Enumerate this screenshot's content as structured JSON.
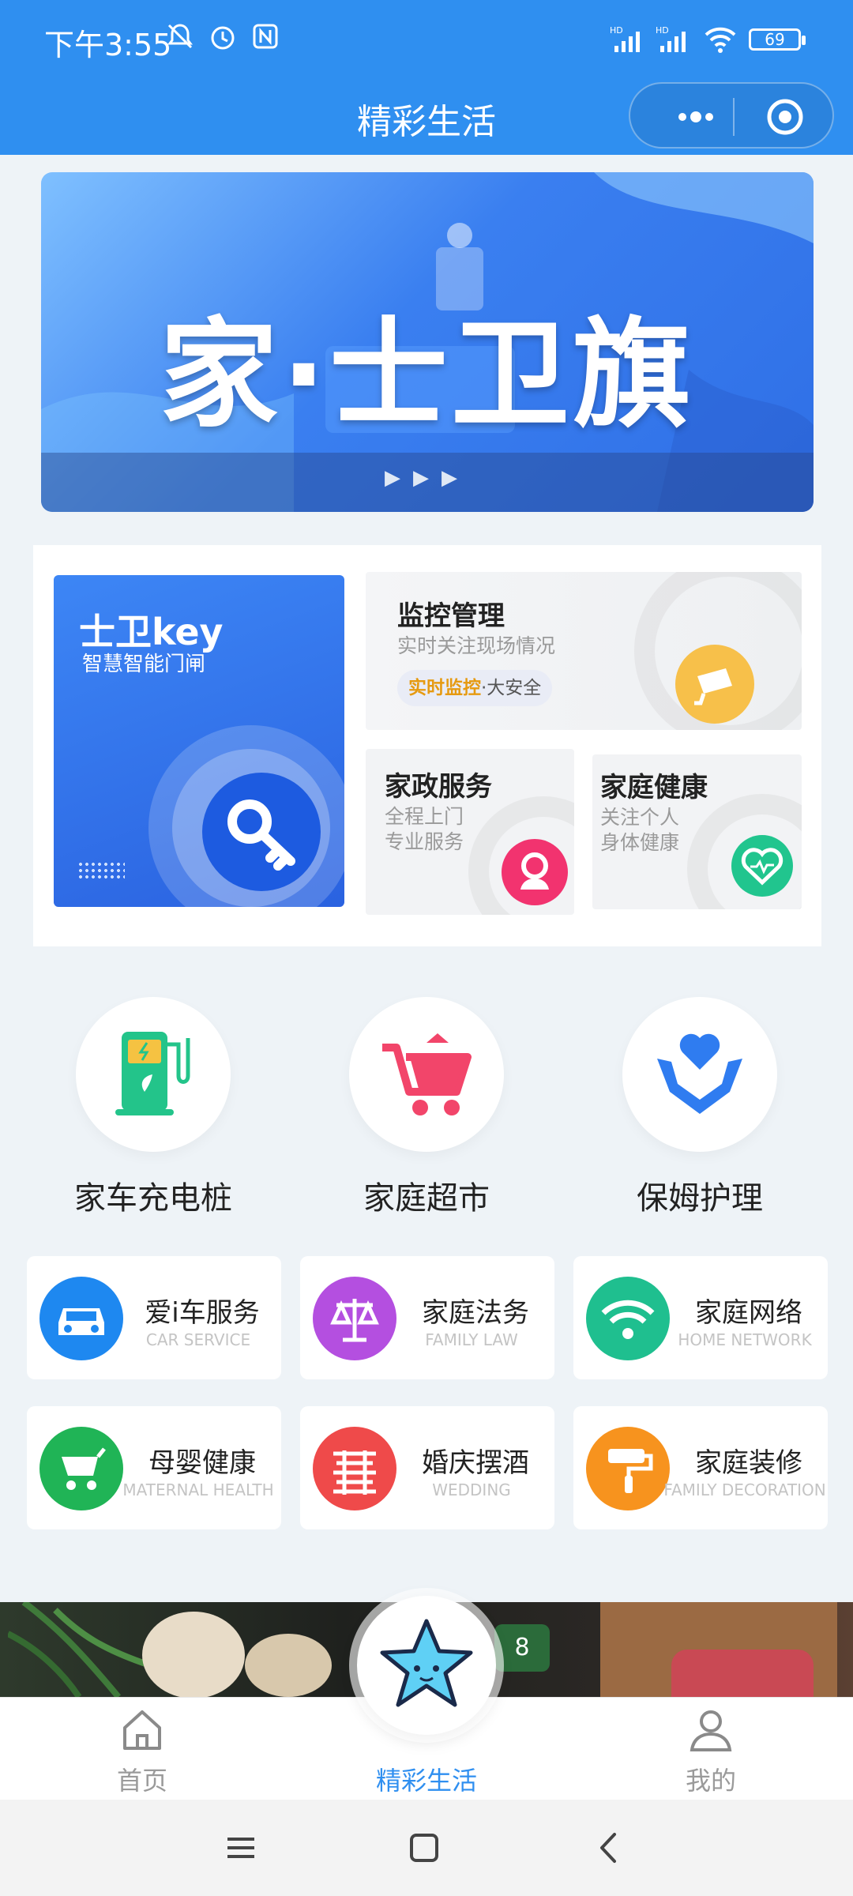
{
  "status_bar": {
    "time": "下午3:55",
    "battery": "69"
  },
  "header": {
    "title": "精彩生活"
  },
  "banner": {
    "text": "家·士卫旗"
  },
  "cards": {
    "key": {
      "title": "士卫key",
      "subtitle": "智慧智能门闸"
    },
    "monitor": {
      "title": "监控管理",
      "subtitle": "实时关注现场情况",
      "tag_highlight": "实时监控",
      "tag_rest": "·大安全"
    },
    "housekeeping": {
      "title": "家政服务",
      "line1": "全程上门",
      "line2": "专业服务"
    },
    "health": {
      "title": "家庭健康",
      "line1": "关注个人",
      "line2": "身体健康"
    }
  },
  "icon_row": [
    {
      "label": "家车充电桩",
      "icon": "ev-charger-icon"
    },
    {
      "label": "家庭超市",
      "icon": "shopping-cart-icon"
    },
    {
      "label": "保姆护理",
      "icon": "care-hands-icon"
    }
  ],
  "services": [
    {
      "name": "爱i车服务",
      "en": "CAR SERVICE",
      "color": "#1e88f0",
      "icon": "car-icon"
    },
    {
      "name": "家庭法务",
      "en": "FAMILY LAW",
      "color": "#b44fe0",
      "icon": "scales-icon"
    },
    {
      "name": "家庭网络",
      "en": "HOME NETWORK",
      "color": "#1fbf8f",
      "icon": "wifi-icon"
    },
    {
      "name": "母婴健康",
      "en": "MATERNAL HEALTH",
      "color": "#20b456",
      "icon": "stroller-icon"
    },
    {
      "name": "婚庆摆酒",
      "en": "WEDDING",
      "color": "#ef4a4a",
      "icon": "double-happiness-icon"
    },
    {
      "name": "家庭装修",
      "en": "FAMILY DECORATION",
      "color": "#f7931e",
      "icon": "paint-roller-icon"
    }
  ],
  "ad": {
    "badge": "8"
  },
  "tabbar": {
    "home": "首页",
    "life": "精彩生活",
    "mine": "我的"
  },
  "colors": {
    "primary": "#2f8ff0",
    "background": "#eef3f7"
  }
}
